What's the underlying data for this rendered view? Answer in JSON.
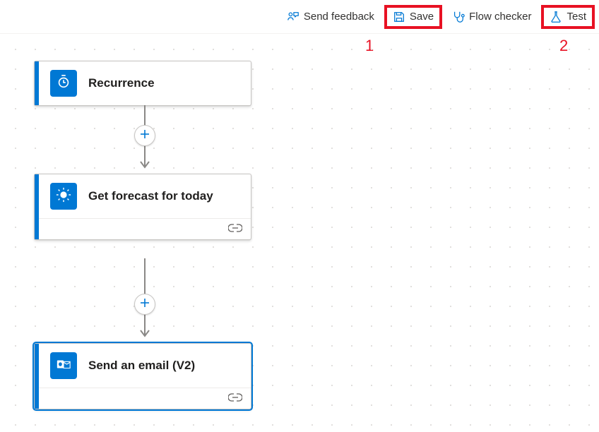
{
  "toolbar": {
    "feedback_label": "Send feedback",
    "save_label": "Save",
    "checker_label": "Flow checker",
    "test_label": "Test"
  },
  "annotations": {
    "save": "1",
    "test": "2"
  },
  "flow": {
    "steps": [
      {
        "title": "Recurrence",
        "badge_color": "#0078d4",
        "icon": "recurrence-icon",
        "footer": false,
        "selected": false
      },
      {
        "title": "Get forecast for today",
        "badge_color": "#0078d4",
        "icon": "weather-icon",
        "footer": true,
        "selected": false
      },
      {
        "title": "Send an email (V2)",
        "badge_color": "#0078d4",
        "icon": "outlook-icon",
        "footer": true,
        "selected": true
      }
    ]
  }
}
